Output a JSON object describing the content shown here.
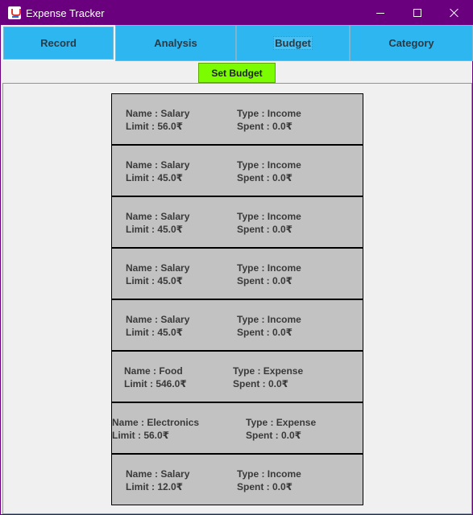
{
  "window": {
    "title": "Expense Tracker"
  },
  "tabs": [
    {
      "label": "Record"
    },
    {
      "label": "Analysis"
    },
    {
      "label": "Budget"
    },
    {
      "label": "Category"
    }
  ],
  "actions": {
    "set_budget": "Set Budget"
  },
  "budgets": [
    {
      "name": "Name : Salary",
      "type": "Type : Income",
      "limit": "Limit : 56.0₹",
      "spent": "Spent : 0.0₹"
    },
    {
      "name": "Name : Salary",
      "type": "Type : Income",
      "limit": "Limit : 45.0₹",
      "spent": "Spent : 0.0₹"
    },
    {
      "name": "Name : Salary",
      "type": "Type : Income",
      "limit": "Limit : 45.0₹",
      "spent": "Spent : 0.0₹"
    },
    {
      "name": "Name : Salary",
      "type": "Type : Income",
      "limit": "Limit : 45.0₹",
      "spent": "Spent : 0.0₹"
    },
    {
      "name": "Name : Salary",
      "type": "Type : Income",
      "limit": "Limit : 45.0₹",
      "spent": "Spent : 0.0₹"
    },
    {
      "name": "Name : Food",
      "type": "Type : Expense",
      "limit": "Limit : 546.0₹",
      "spent": "Spent : 0.0₹"
    },
    {
      "name": "Name : Electronics",
      "type": "Type : Expense",
      "limit": "Limit : 56.0₹",
      "spent": "Spent : 0.0₹"
    },
    {
      "name": "Name : Salary",
      "type": "Type : Income",
      "limit": "Limit : 12.0₹",
      "spent": "Spent : 0.0₹"
    }
  ]
}
